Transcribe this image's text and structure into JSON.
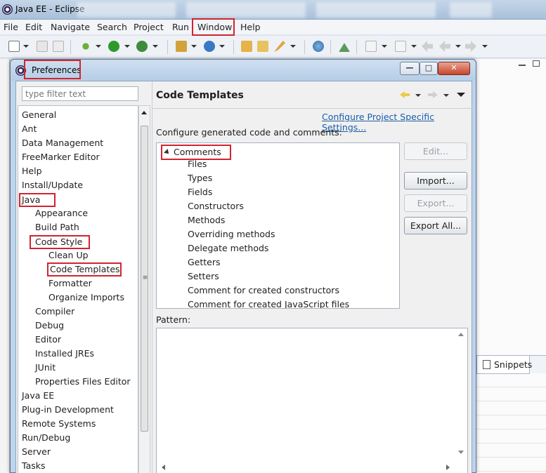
{
  "window": {
    "title": "Java EE - Eclipse"
  },
  "menubar": {
    "items": [
      "File",
      "Edit",
      "Navigate",
      "Search",
      "Project",
      "Run",
      "Window",
      "Help"
    ]
  },
  "dialog": {
    "title": "Preferences",
    "filter_placeholder": "type filter text",
    "nav_items": [
      "General",
      "Ant",
      "Data Management",
      "FreeMarker Editor",
      "Help",
      "Install/Update",
      "Java",
      "Appearance",
      "Build Path",
      "Code Style",
      "Clean Up",
      "Code Templates",
      "Formatter",
      "Organize Imports",
      "Compiler",
      "Debug",
      "Editor",
      "Installed JREs",
      "JUnit",
      "Properties Files Editor",
      "Java EE",
      "Plug-in Development",
      "Remote Systems",
      "Run/Debug",
      "Server",
      "Tasks"
    ],
    "page": {
      "title": "Code Templates",
      "config_link": "Configure Project Specific Settings...",
      "configure_label": "Configure generated code and comments:",
      "tree_root": "Comments",
      "tree_children": [
        "Files",
        "Types",
        "Fields",
        "Constructors",
        "Methods",
        "Overriding methods",
        "Delegate methods",
        "Getters",
        "Setters",
        "Comment for created constructors",
        "Comment for created JavaScript files"
      ],
      "buttons": {
        "edit": "Edit...",
        "import": "Import...",
        "export": "Export...",
        "export_all": "Export All..."
      },
      "pattern_label": "Pattern:"
    }
  },
  "background": {
    "snippets_tab": "Snippets"
  },
  "colors": {
    "highlight_red": "#d1242f",
    "link_blue": "#1a5ea8"
  }
}
